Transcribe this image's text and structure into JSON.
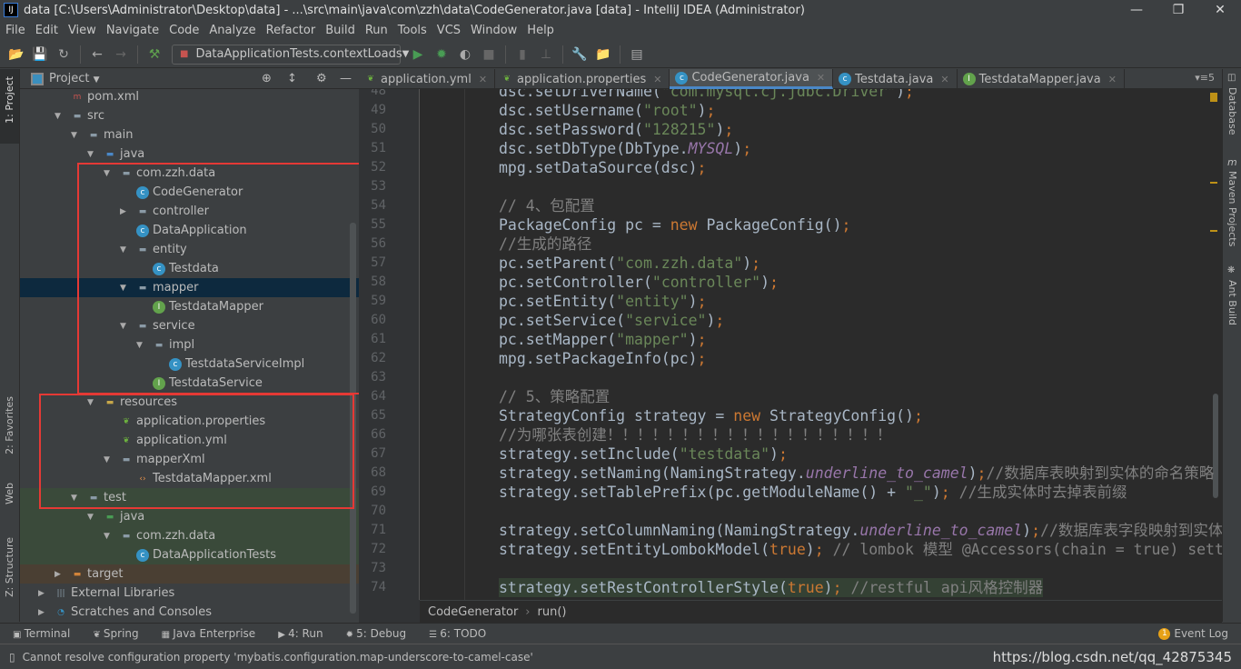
{
  "window": {
    "title": "data [C:\\Users\\Administrator\\Desktop\\data] - ...\\src\\main\\java\\com\\zzh\\data\\CodeGenerator.java [data] - IntelliJ IDEA (Administrator)",
    "logo": "IJ"
  },
  "menu": [
    "File",
    "Edit",
    "View",
    "Navigate",
    "Code",
    "Analyze",
    "Refactor",
    "Build",
    "Run",
    "Tools",
    "VCS",
    "Window",
    "Help"
  ],
  "toolbar": {
    "run_config": "DataApplicationTests.contextLoads"
  },
  "left_strip": {
    "project": "1: Project",
    "favorites": "2: Favorites",
    "web": "Web",
    "structure": "Z: Structure"
  },
  "right_strip": {
    "database": "Database",
    "maven": "Maven Projects",
    "ant": "Ant Build"
  },
  "project_panel": {
    "title": "Project"
  },
  "tree": [
    {
      "label": "pom.xml",
      "depth": 2,
      "icon": "maven",
      "expand": "none"
    },
    {
      "label": "src",
      "depth": 2,
      "icon": "folder",
      "expand": "open"
    },
    {
      "label": "main",
      "depth": 3,
      "icon": "folder",
      "expand": "open"
    },
    {
      "label": "java",
      "depth": 4,
      "icon": "source-folder",
      "expand": "open"
    },
    {
      "label": "com.zzh.data",
      "depth": 5,
      "icon": "package",
      "expand": "open"
    },
    {
      "label": "CodeGenerator",
      "depth": 6,
      "icon": "class-runnable",
      "expand": "none"
    },
    {
      "label": "controller",
      "depth": 6,
      "icon": "package",
      "expand": "closed"
    },
    {
      "label": "DataApplication",
      "depth": 6,
      "icon": "class-spring",
      "expand": "none"
    },
    {
      "label": "entity",
      "depth": 6,
      "icon": "package",
      "expand": "open"
    },
    {
      "label": "Testdata",
      "depth": 7,
      "icon": "class",
      "expand": "none"
    },
    {
      "label": "mapper",
      "depth": 6,
      "icon": "package",
      "expand": "open",
      "selected": true
    },
    {
      "label": "TestdataMapper",
      "depth": 7,
      "icon": "interface",
      "expand": "none"
    },
    {
      "label": "service",
      "depth": 6,
      "icon": "package",
      "expand": "open"
    },
    {
      "label": "impl",
      "depth": 7,
      "icon": "package",
      "expand": "open"
    },
    {
      "label": "TestdataServiceImpl",
      "depth": 8,
      "icon": "class",
      "expand": "none"
    },
    {
      "label": "TestdataService",
      "depth": 7,
      "icon": "interface",
      "expand": "none"
    },
    {
      "label": "resources",
      "depth": 4,
      "icon": "resources-folder",
      "expand": "open"
    },
    {
      "label": "application.properties",
      "depth": 5,
      "icon": "spring-config",
      "expand": "none"
    },
    {
      "label": "application.yml",
      "depth": 5,
      "icon": "spring-config",
      "expand": "none"
    },
    {
      "label": "mapperXml",
      "depth": 5,
      "icon": "folder",
      "expand": "open"
    },
    {
      "label": "TestdataMapper.xml",
      "depth": 6,
      "icon": "xml",
      "expand": "none"
    },
    {
      "label": "test",
      "depth": 3,
      "icon": "folder",
      "expand": "open",
      "scope": "test"
    },
    {
      "label": "java",
      "depth": 4,
      "icon": "test-folder",
      "expand": "open",
      "scope": "test"
    },
    {
      "label": "com.zzh.data",
      "depth": 5,
      "icon": "package",
      "expand": "open",
      "scope": "test"
    },
    {
      "label": "DataApplicationTests",
      "depth": 6,
      "icon": "class-spring",
      "expand": "none",
      "scope": "test"
    },
    {
      "label": "target",
      "depth": 2,
      "icon": "excluded-folder",
      "expand": "closed",
      "scope": "excluded"
    },
    {
      "label": "External Libraries",
      "depth": 1,
      "icon": "libraries",
      "expand": "closed"
    },
    {
      "label": "Scratches and Consoles",
      "depth": 1,
      "icon": "scratches",
      "expand": "closed"
    }
  ],
  "tabs": [
    {
      "label": "application.yml",
      "icon": "spring-config"
    },
    {
      "label": "application.properties",
      "icon": "spring-config"
    },
    {
      "label": "CodeGenerator.java",
      "icon": "class-runnable",
      "active": true
    },
    {
      "label": "Testdata.java",
      "icon": "class"
    },
    {
      "label": "TestdataMapper.java",
      "icon": "interface"
    }
  ],
  "tabs_overflow": "5",
  "code": [
    {
      "n": 48,
      "seg": [
        [
          "pl",
          "dsc.setDriverName("
        ],
        [
          "str",
          "\"com.mysql.cj.jdbc.Driver\""
        ],
        [
          "pl",
          ")"
        ],
        [
          "kw",
          ";"
        ]
      ]
    },
    {
      "n": 49,
      "seg": [
        [
          "pl",
          "dsc.setUsername("
        ],
        [
          "str",
          "\"root\""
        ],
        [
          "pl",
          ")"
        ],
        [
          "kw",
          ";"
        ]
      ]
    },
    {
      "n": 50,
      "seg": [
        [
          "pl",
          "dsc.setPassword("
        ],
        [
          "str",
          "\"128215\""
        ],
        [
          "pl",
          ")"
        ],
        [
          "kw",
          ";"
        ]
      ]
    },
    {
      "n": 51,
      "seg": [
        [
          "pl",
          "dsc.setDbType(DbType."
        ],
        [
          "st",
          "MYSQL"
        ],
        [
          "pl",
          ")"
        ],
        [
          "kw",
          ";"
        ]
      ]
    },
    {
      "n": 52,
      "seg": [
        [
          "pl",
          "mpg.setDataSource(dsc)"
        ],
        [
          "kw",
          ";"
        ]
      ]
    },
    {
      "n": 53,
      "seg": []
    },
    {
      "n": 54,
      "seg": [
        [
          "cm",
          "// 4、包配置"
        ]
      ]
    },
    {
      "n": 55,
      "seg": [
        [
          "pl",
          "PackageConfig pc = "
        ],
        [
          "kw",
          "new "
        ],
        [
          "pl",
          "PackageConfig()"
        ],
        [
          "kw",
          ";"
        ]
      ]
    },
    {
      "n": 56,
      "seg": [
        [
          "cm",
          "//生成的路径"
        ]
      ]
    },
    {
      "n": 57,
      "seg": [
        [
          "pl",
          "pc.setParent("
        ],
        [
          "str",
          "\"com.zzh.data\""
        ],
        [
          "pl",
          ")"
        ],
        [
          "kw",
          ";"
        ]
      ]
    },
    {
      "n": 58,
      "seg": [
        [
          "pl",
          "pc.setController("
        ],
        [
          "str",
          "\"controller\""
        ],
        [
          "pl",
          ")"
        ],
        [
          "kw",
          ";"
        ]
      ]
    },
    {
      "n": 59,
      "seg": [
        [
          "pl",
          "pc.setEntity("
        ],
        [
          "str",
          "\"entity\""
        ],
        [
          "pl",
          ")"
        ],
        [
          "kw",
          ";"
        ]
      ]
    },
    {
      "n": 60,
      "seg": [
        [
          "pl",
          "pc.setService("
        ],
        [
          "str",
          "\"service\""
        ],
        [
          "pl",
          ")"
        ],
        [
          "kw",
          ";"
        ]
      ]
    },
    {
      "n": 61,
      "seg": [
        [
          "pl",
          "pc.setMapper("
        ],
        [
          "str",
          "\"mapper\""
        ],
        [
          "pl",
          ")"
        ],
        [
          "kw",
          ";"
        ]
      ]
    },
    {
      "n": 62,
      "seg": [
        [
          "pl",
          "mpg.setPackageInfo(pc)"
        ],
        [
          "kw",
          ";"
        ]
      ]
    },
    {
      "n": 63,
      "seg": []
    },
    {
      "n": 64,
      "seg": [
        [
          "cm",
          "// 5、策略配置"
        ]
      ]
    },
    {
      "n": 65,
      "seg": [
        [
          "pl",
          "StrategyConfig strategy = "
        ],
        [
          "kw",
          "new "
        ],
        [
          "pl",
          "StrategyConfig()"
        ],
        [
          "kw",
          ";"
        ]
      ]
    },
    {
      "n": 66,
      "seg": [
        [
          "cm",
          "//为哪张表创建！！！！！！！！！！！！！！！！！！！"
        ]
      ]
    },
    {
      "n": 67,
      "seg": [
        [
          "pl",
          "strategy.setInclude("
        ],
        [
          "str",
          "\"testdata\""
        ],
        [
          "pl",
          ")"
        ],
        [
          "kw",
          ";"
        ]
      ]
    },
    {
      "n": 68,
      "seg": [
        [
          "pl",
          "strategy.setNaming(NamingStrategy."
        ],
        [
          "st",
          "underline_to_camel"
        ],
        [
          "pl",
          ")"
        ],
        [
          "kw",
          ";"
        ],
        [
          "cm",
          "//数据库表映射到实体的命名策略"
        ]
      ]
    },
    {
      "n": 69,
      "seg": [
        [
          "pl",
          "strategy.setTablePrefix(pc.getModuleName() + "
        ],
        [
          "str",
          "\"_\""
        ],
        [
          "pl",
          ")"
        ],
        [
          "kw",
          ";"
        ],
        [
          "cm",
          " //生成实体时去掉表前缀"
        ]
      ]
    },
    {
      "n": 70,
      "seg": []
    },
    {
      "n": 71,
      "seg": [
        [
          "pl",
          "strategy.setColumnNaming(NamingStrategy."
        ],
        [
          "st",
          "underline_to_camel"
        ],
        [
          "pl",
          ")"
        ],
        [
          "kw",
          ";"
        ],
        [
          "cm",
          "//数据库表字段映射到实体"
        ]
      ]
    },
    {
      "n": 72,
      "seg": [
        [
          "pl",
          "strategy.setEntityLombokModel("
        ],
        [
          "kw",
          "true"
        ],
        [
          "pl",
          ")"
        ],
        [
          "kw",
          ";"
        ],
        [
          "cm",
          " // lombok 模型 @Accessors(chain = true) sett"
        ]
      ]
    },
    {
      "n": 73,
      "seg": []
    },
    {
      "n": 74,
      "seg": [
        [
          "pl",
          "strategy.setRestControllerStyle("
        ],
        [
          "kw",
          "true"
        ],
        [
          "pl",
          ")"
        ],
        [
          "kw",
          ";"
        ],
        [
          "cm",
          " //restful api风格控制器"
        ]
      ]
    }
  ],
  "breadcrumb": [
    "CodeGenerator",
    "run()"
  ],
  "bottom_tools": [
    {
      "label": "Terminal",
      "icon": "terminal"
    },
    {
      "label": "Spring",
      "icon": "spring"
    },
    {
      "label": "Java Enterprise",
      "icon": "java-enterprise"
    },
    {
      "label": "4: Run",
      "icon": "run"
    },
    {
      "label": "5: Debug",
      "icon": "debug"
    },
    {
      "label": "6: TODO",
      "icon": "todo"
    }
  ],
  "event_log": {
    "label": "Event Log",
    "count": "1"
  },
  "status": {
    "message": "Cannot resolve configuration property 'mybatis.configuration.map-underscore-to-camel-case'",
    "watermark": "https://blog.csdn.net/qq_42875345"
  },
  "colors": {
    "accent": "#4a88c7",
    "highlight_box": "#e53935",
    "selected_row": "#0d293e",
    "test_scope": "#3a4a3a",
    "excluded_scope": "#4a3f33"
  }
}
